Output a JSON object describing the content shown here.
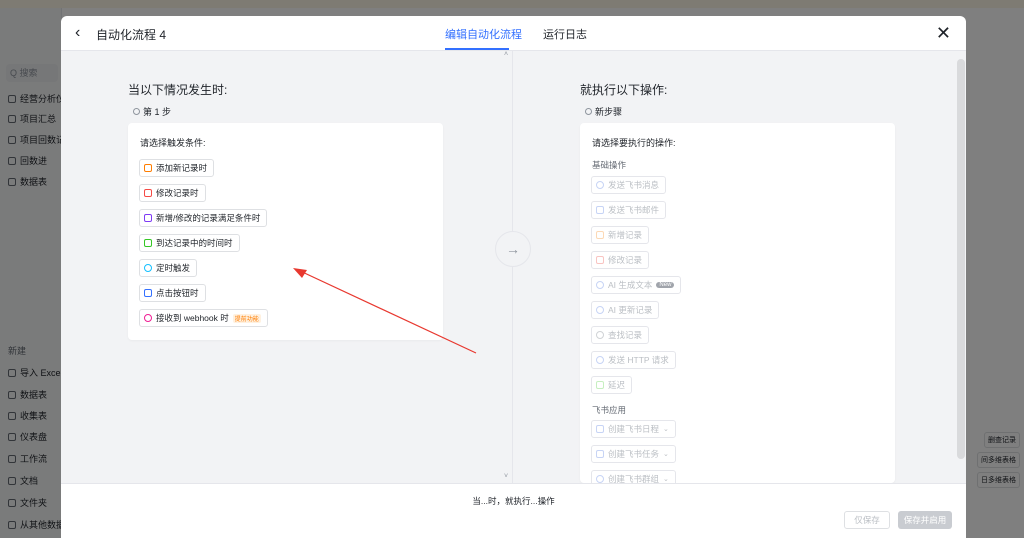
{
  "background": {
    "search_placeholder": "Q 搜索",
    "sidebar_items": [
      "经营分析仪",
      "项目汇总",
      "项目回数记",
      "回数进",
      "数据表"
    ],
    "sidebar_section": "新建",
    "sidebar_new_items": [
      "导入 Excel",
      "数据表",
      "收集表",
      "仪表盘",
      "工作流",
      "文档",
      "文件夹",
      "从其他数据"
    ],
    "right_buttons": [
      "删查记录",
      "间多维表格",
      "日多维表格"
    ]
  },
  "header": {
    "title": "自动化流程 4",
    "tabs": [
      {
        "label": "编辑自动化流程",
        "active": true
      },
      {
        "label": "运行日志",
        "active": false
      }
    ],
    "close_icon": "close-icon",
    "back_icon": "chevron-left-icon"
  },
  "left": {
    "title": "当以下情况发生时:",
    "step": "第 1 步",
    "card_title": "请选择触发条件:",
    "options": [
      {
        "label": "添加新记录时",
        "icon": "add-record-icon",
        "color": "#ff7d00"
      },
      {
        "label": "修改记录时",
        "icon": "edit-icon",
        "color": "#f54a45"
      },
      {
        "label": "新增/修改的记录满足条件时",
        "icon": "filter-icon",
        "color": "#7f3bf5"
      },
      {
        "label": "到达记录中的时间时",
        "icon": "calendar-icon",
        "color": "#34c724"
      },
      {
        "label": "定时触发",
        "icon": "clock-icon",
        "color": "#14c0ff"
      },
      {
        "label": "点击按钮时",
        "icon": "button-icon",
        "color": "#3370ff"
      },
      {
        "label": "接收到 webhook 时",
        "icon": "webhook-icon",
        "color": "#f01d94",
        "tag": "提前功能"
      }
    ]
  },
  "right": {
    "title": "就执行以下操作:",
    "step": "新步骤",
    "card_title": "请选择要执行的操作:",
    "section_basic": "基础操作",
    "basic_options": [
      {
        "label": "发送飞书消息",
        "icon": "message-icon"
      },
      {
        "label": "发送飞书邮件",
        "icon": "mail-icon"
      },
      {
        "label": "新增记录",
        "icon": "add-record-icon"
      },
      {
        "label": "修改记录",
        "icon": "edit-icon"
      },
      {
        "label": "AI 生成文本",
        "icon": "ai-icon",
        "badge": "New"
      },
      {
        "label": "AI 更新记录",
        "icon": "refresh-icon"
      },
      {
        "label": "查找记录",
        "icon": "search-icon"
      },
      {
        "label": "发送 HTTP 请求",
        "icon": "globe-icon"
      },
      {
        "label": "延迟",
        "icon": "hourglass-icon"
      }
    ],
    "section_apps": "飞书应用",
    "app_options": [
      {
        "label": "创建飞书日程",
        "icon": "calendar-icon"
      },
      {
        "label": "创建飞书任务",
        "icon": "check-icon"
      },
      {
        "label": "创建飞书群组",
        "icon": "group-icon"
      }
    ]
  },
  "footer": {
    "summary": "当...时，就执行...操作",
    "save_label": "仅保存",
    "enable_label": "保存并启用"
  },
  "colors": {
    "accent": "#3370ff",
    "annotation_arrow": "#e8382f"
  }
}
